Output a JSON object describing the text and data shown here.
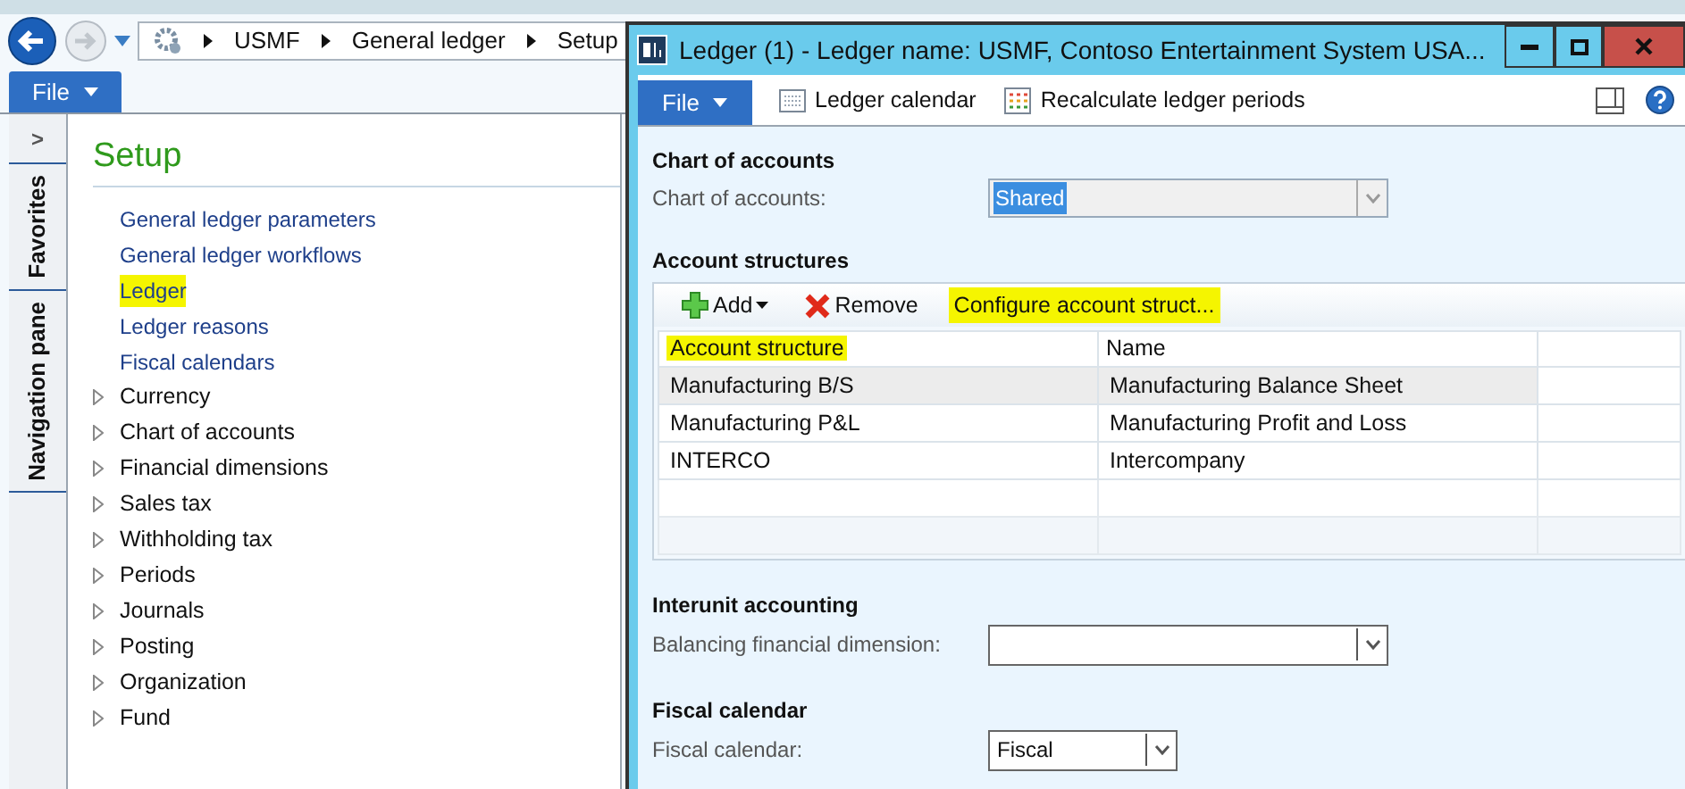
{
  "main_window": {
    "breadcrumb": [
      "USMF",
      "General ledger",
      "Setup"
    ],
    "file_menu": "File",
    "side_tabs": [
      {
        "label": "Favorites"
      },
      {
        "label": "Navigation pane"
      }
    ],
    "side_toggle": ">",
    "page_title": "Setup",
    "nav_items": [
      {
        "kind": "link",
        "label": "General ledger parameters",
        "highlighted": false
      },
      {
        "kind": "link",
        "label": "General ledger workflows",
        "highlighted": false
      },
      {
        "kind": "link",
        "label": "Ledger",
        "highlighted": true
      },
      {
        "kind": "link",
        "label": "Ledger reasons",
        "highlighted": false
      },
      {
        "kind": "link",
        "label": "Fiscal calendars",
        "highlighted": false
      },
      {
        "kind": "group",
        "label": "Currency",
        "expanded": false
      },
      {
        "kind": "group",
        "label": "Chart of accounts",
        "expanded": false
      },
      {
        "kind": "group",
        "label": "Financial dimensions",
        "expanded": false
      },
      {
        "kind": "group",
        "label": "Sales tax",
        "expanded": false
      },
      {
        "kind": "group",
        "label": "Withholding tax",
        "expanded": false
      },
      {
        "kind": "group",
        "label": "Periods",
        "expanded": false
      },
      {
        "kind": "group",
        "label": "Journals",
        "expanded": false
      },
      {
        "kind": "group",
        "label": "Posting",
        "expanded": false
      },
      {
        "kind": "group",
        "label": "Organization",
        "expanded": false
      },
      {
        "kind": "group",
        "label": "Fund",
        "expanded": false
      }
    ]
  },
  "dialog": {
    "title": "Ledger (1) - Ledger name: USMF, Contoso Entertainment System USA...",
    "file_menu": "File",
    "toolbar": [
      {
        "label": "Ledger calendar",
        "kind": "calendar"
      },
      {
        "label": "Recalculate ledger periods",
        "kind": "grid"
      }
    ],
    "chart_of_accounts": {
      "heading": "Chart of accounts",
      "label": "Chart of accounts:",
      "value": "Shared",
      "disabled": true
    },
    "account_structures": {
      "heading": "Account structures",
      "actions": [
        {
          "label": "Add",
          "kind": "add",
          "highlighted": false
        },
        {
          "label": "Remove",
          "kind": "remove",
          "highlighted": false
        },
        {
          "label": "Configure account struct...",
          "kind": "plain",
          "highlighted": true
        }
      ],
      "columns": [
        {
          "label": "Account structure",
          "highlighted": true
        },
        {
          "label": "Name",
          "highlighted": false
        }
      ],
      "rows": [
        {
          "cells": [
            "Manufacturing B/S",
            "Manufacturing Balance Sheet"
          ],
          "selected": true
        },
        {
          "cells": [
            "Manufacturing P&L",
            "Manufacturing Profit and Loss"
          ],
          "selected": false
        },
        {
          "cells": [
            "INTERCO",
            "Intercompany"
          ],
          "selected": false
        }
      ]
    },
    "interunit": {
      "heading": "Interunit accounting",
      "label": "Balancing financial dimension:"
    },
    "fiscal_calendar": {
      "heading": "Fiscal calendar",
      "label": "Fiscal calendar:",
      "value": "Fiscal"
    }
  }
}
